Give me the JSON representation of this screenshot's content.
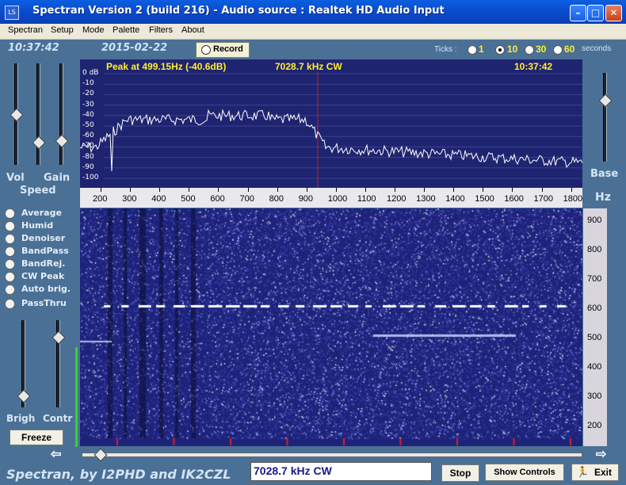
{
  "window": {
    "title": "Spectran Version 2 (build 216) - Audio source  :  Realtek HD Audio Input"
  },
  "menu": [
    "Spectran",
    "Setup",
    "Mode",
    "Palette",
    "Filters",
    "About"
  ],
  "clock": "10:37:42",
  "date": "2015-02-22",
  "record_label": "Record",
  "ticks": {
    "label": "Ticks :",
    "options": [
      "1",
      "10",
      "30",
      "60"
    ],
    "selected": "10",
    "unit": "seconds"
  },
  "peak": {
    "text": "Peak at   499.15Hz (-40.6dB)",
    "freq": "7028.7 kHz CW",
    "time": "10:37:42"
  },
  "db_labels": [
    "0 dB",
    "-10",
    "-20",
    "-30",
    "-40",
    "-50",
    "-60",
    "-70",
    "-80",
    "-90",
    "-100"
  ],
  "freq_labels": [
    "200",
    "300",
    "400",
    "500",
    "600",
    "700",
    "800",
    "900",
    "1000",
    "1100",
    "1200",
    "1300",
    "1400",
    "1500",
    "1600",
    "1700",
    "1800"
  ],
  "hz_labels": [
    "900",
    "800",
    "700",
    "600",
    "500",
    "400",
    "300",
    "200"
  ],
  "hz_unit": "Hz",
  "left": {
    "vol": "Vol",
    "gain": "Gain",
    "speed": "Speed",
    "brigh": "Brigh",
    "contr": "Contr"
  },
  "base_label": "Base",
  "filters": [
    "Average",
    "Humid",
    "Denoiser",
    "BandPass",
    "BandRej.",
    "CW Peak",
    "Auto brig.",
    "PassThru"
  ],
  "freeze_label": "Freeze",
  "freq_box": "7028.7 kHz CW",
  "buttons": {
    "stop": "Stop",
    "show_controls": "Show Controls",
    "exit": "Exit"
  },
  "footer": "Spectran, by I2PHD and IK2CZL",
  "colors": {
    "spectrum_bg": "#1f2470",
    "waterfall_bg": "#1e237a",
    "peak_text": "#ffee33",
    "window_bg": "#4a7096"
  }
}
